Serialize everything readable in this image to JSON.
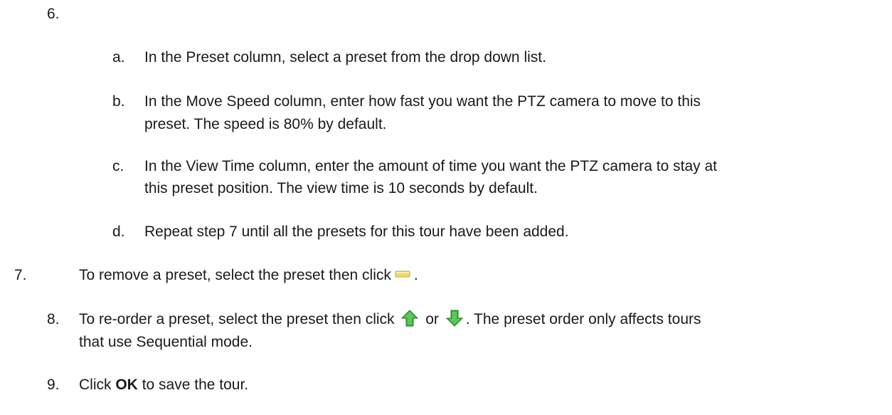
{
  "step6": {
    "number": "6.",
    "substeps": [
      {
        "letter": "a.",
        "lines": [
          "In the Preset column, select a preset from the drop down list."
        ]
      },
      {
        "letter": "b.",
        "lines": [
          "In the Move Speed column, enter how fast you want the PTZ camera to move to this",
          "preset. The speed is 80% by default."
        ]
      },
      {
        "letter": "c.",
        "lines": [
          "In the View Time column, enter the amount of time you want the PTZ camera to stay at",
          "this preset position. The view time is 10 seconds by default."
        ]
      },
      {
        "letter": "d.",
        "lines": [
          "Repeat step 7 until all the presets for this tour have been added."
        ]
      }
    ]
  },
  "step7": {
    "number": "7.",
    "text_before": "To remove a preset, select the preset then click",
    "text_after": ".",
    "icon": "remove-preset-icon"
  },
  "step8": {
    "number": "8.",
    "text_before": "To re-order a preset, select the preset then click",
    "or": "or",
    "text_after": ". The preset order only affects tours",
    "line2": "that use Sequential mode.",
    "icons": [
      "move-up-icon",
      "move-down-icon"
    ]
  },
  "step9": {
    "number": "9.",
    "text_before": "Click",
    "bold": "OK",
    "text_after": "to save the tour."
  },
  "colors": {
    "text": "#1a1a1a",
    "remove_icon": "#f0d86a",
    "arrow_green": "#3cb43c"
  }
}
